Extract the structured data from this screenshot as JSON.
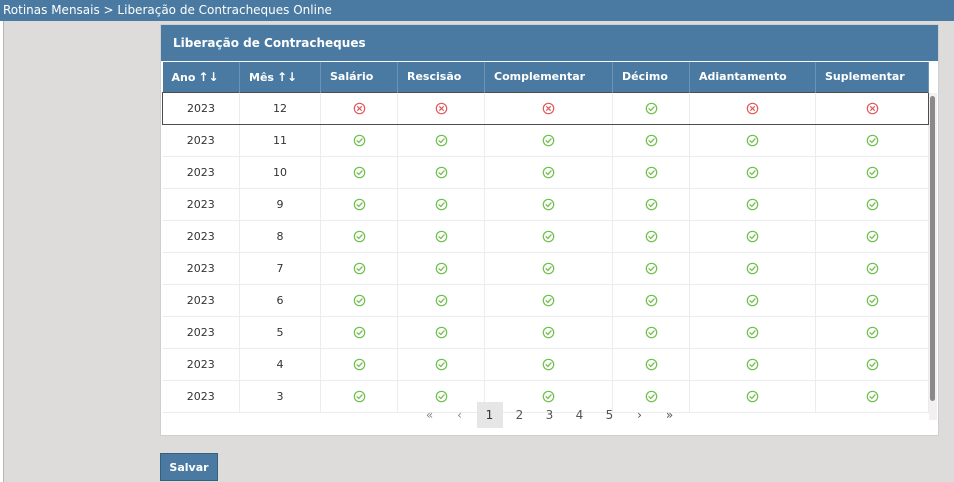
{
  "breadcrumb": "Rotinas Mensais > Liberação de Contracheques Online",
  "panel": {
    "title": "Liberação de Contracheques"
  },
  "colors": {
    "accent": "#4a7aa2",
    "ok": "#6cc04a",
    "no": "#e05a5a"
  },
  "table": {
    "sort_glyph": "↑↓",
    "columns": [
      {
        "label": "Ano",
        "sortable": true
      },
      {
        "label": "Mês",
        "sortable": true
      },
      {
        "label": "Salário",
        "sortable": false
      },
      {
        "label": "Rescisão",
        "sortable": false
      },
      {
        "label": "Complementar",
        "sortable": false
      },
      {
        "label": "Décimo",
        "sortable": false
      },
      {
        "label": "Adiantamento",
        "sortable": false
      },
      {
        "label": "Suplementar",
        "sortable": false
      }
    ],
    "rows": [
      {
        "ano": "2023",
        "mes": "12",
        "selected": true,
        "flags": [
          "no",
          "no",
          "no",
          "ok",
          "no",
          "no"
        ]
      },
      {
        "ano": "2023",
        "mes": "11",
        "selected": false,
        "flags": [
          "ok",
          "ok",
          "ok",
          "ok",
          "ok",
          "ok"
        ]
      },
      {
        "ano": "2023",
        "mes": "10",
        "selected": false,
        "flags": [
          "ok",
          "ok",
          "ok",
          "ok",
          "ok",
          "ok"
        ]
      },
      {
        "ano": "2023",
        "mes": "9",
        "selected": false,
        "flags": [
          "ok",
          "ok",
          "ok",
          "ok",
          "ok",
          "ok"
        ]
      },
      {
        "ano": "2023",
        "mes": "8",
        "selected": false,
        "flags": [
          "ok",
          "ok",
          "ok",
          "ok",
          "ok",
          "ok"
        ]
      },
      {
        "ano": "2023",
        "mes": "7",
        "selected": false,
        "flags": [
          "ok",
          "ok",
          "ok",
          "ok",
          "ok",
          "ok"
        ]
      },
      {
        "ano": "2023",
        "mes": "6",
        "selected": false,
        "flags": [
          "ok",
          "ok",
          "ok",
          "ok",
          "ok",
          "ok"
        ]
      },
      {
        "ano": "2023",
        "mes": "5",
        "selected": false,
        "flags": [
          "ok",
          "ok",
          "ok",
          "ok",
          "ok",
          "ok"
        ]
      },
      {
        "ano": "2023",
        "mes": "4",
        "selected": false,
        "flags": [
          "ok",
          "ok",
          "ok",
          "ok",
          "ok",
          "ok"
        ]
      },
      {
        "ano": "2023",
        "mes": "3",
        "selected": false,
        "flags": [
          "ok",
          "ok",
          "ok",
          "ok",
          "ok",
          "ok"
        ]
      }
    ]
  },
  "pagination": {
    "first": "«",
    "prev": "‹",
    "pages": [
      "1",
      "2",
      "3",
      "4",
      "5"
    ],
    "current": "1",
    "next": "›",
    "last": "»"
  },
  "actions": {
    "save_label": "Salvar"
  }
}
